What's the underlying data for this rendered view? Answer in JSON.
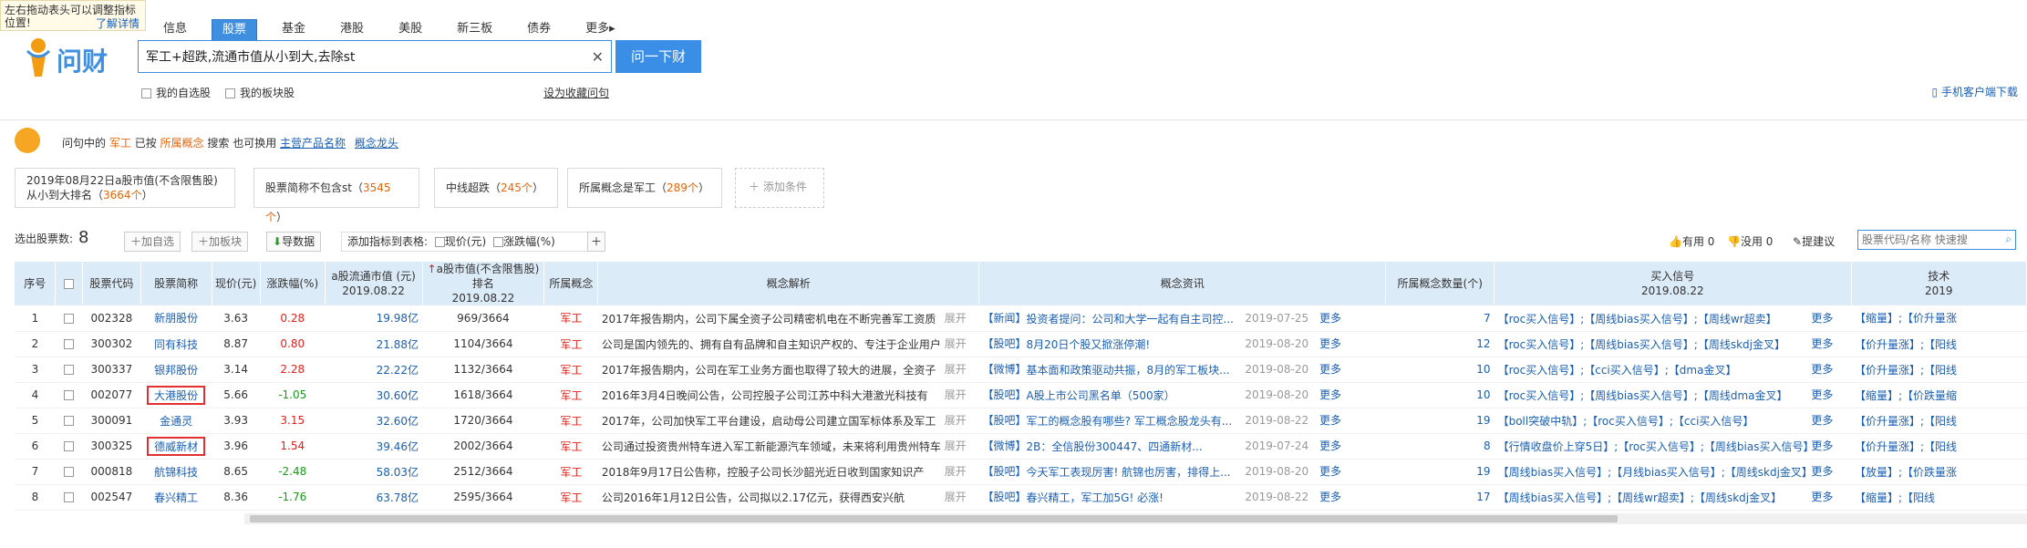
{
  "tooltip": {
    "text": "左右拖动表头可以调整指标位置!",
    "link": "了解详情"
  },
  "logo": {
    "text": "问财"
  },
  "nav": [
    "信息",
    "股票",
    "基金",
    "港股",
    "美股",
    "新三板",
    "债券",
    "更多▸"
  ],
  "search": {
    "value": "军工+超跌,流通市值从小到大,去除st",
    "button": "问一下财"
  },
  "options": {
    "self_select": "我的自选股",
    "my_block": "我的板块股",
    "save_question": "设为收藏问句",
    "phone": "手机客户端下载"
  },
  "info": {
    "prefix": "问句中的",
    "kw": "军工",
    "mid": "已按",
    "concept": "所属概念",
    "mid2": "搜索   也可换用",
    "alt1": "主营产品名称",
    "alt2": "概念龙头"
  },
  "conditions": [
    {
      "label": "2019年08月22日a股市值(不含限售股)从小到大排名",
      "count": "3664个"
    },
    {
      "label": "股票简称不包含st",
      "count": "3545个"
    },
    {
      "label": "中线超跌",
      "count": "245个"
    },
    {
      "label": "所属概念是军工",
      "count": "289个"
    },
    {
      "label": "添加条件",
      "count": ""
    }
  ],
  "toolbar": {
    "count_label": "选出股票数:",
    "count": "8",
    "add_select": "加自选",
    "add_block": "加板块",
    "export": "导数据",
    "add_indicator": "添加指标到表格:",
    "price_chk": "现价(元)",
    "change_chk": "涨跌幅(%)",
    "useful": "有用 0",
    "useless": "没用 0",
    "suggest": "提建议",
    "quick_placeholder": "股票代码/名称 快速搜"
  },
  "table": {
    "headers": [
      {
        "l1": "序号",
        "l2": ""
      },
      {
        "l1": "",
        "l2": ""
      },
      {
        "l1": "股票代码",
        "l2": ""
      },
      {
        "l1": "股票简称",
        "l2": ""
      },
      {
        "l1": "现价(元)",
        "l2": ""
      },
      {
        "l1": "涨跌幅(%)",
        "l2": ""
      },
      {
        "l1": "a股流通市值 (元)",
        "l2": "2019.08.22"
      },
      {
        "l1": "a股市值(不含限售股)排名",
        "l2": "2019.08.22"
      },
      {
        "l1": "所属概念",
        "l2": ""
      },
      {
        "l1": "概念解析",
        "l2": ""
      },
      {
        "l1": "概念资讯",
        "l2": ""
      },
      {
        "l1": "所属概念数量(个)",
        "l2": ""
      },
      {
        "l1": "买入信号",
        "l2": "2019.08.22"
      },
      {
        "l1": "技术",
        "l2": "2019"
      }
    ],
    "sort_arrow": "↑",
    "expand": "展开",
    "more": "更多",
    "rows": [
      {
        "no": "1",
        "code": "002328",
        "name": "新朋股份",
        "price": "3.63",
        "chg": "0.28",
        "cap": "19.98亿",
        "rank": "969/3664",
        "concept": "军工",
        "desc": "2017年报告期内，公司下属全资子公司精密机电在不断完善军工资质",
        "news_tag": "【新闻】",
        "news": "投资者提问：公司和大学一起有自主司控...",
        "news_date": "2019-07-25",
        "num": "7",
        "buy": "【roc买入信号】;【周线bias买入信号】;【周线wr超卖】",
        "tech": "【缩量】;【价升量涨"
      },
      {
        "no": "2",
        "code": "300302",
        "name": "同有科技",
        "price": "8.87",
        "chg": "0.80",
        "cap": "21.88亿",
        "rank": "1104/3664",
        "concept": "军工",
        "desc": "公司是国内领先的、拥有自有品牌和自主知识产权的、专注于企业用户市",
        "news_tag": "【股吧】",
        "news": "8月20日个股又掀涨停潮!",
        "news_date": "2019-08-20",
        "num": "12",
        "buy": "【roc买入信号】;【周线bias买入信号】;【周线skdj金叉】",
        "tech": "【价升量涨】;【阳线"
      },
      {
        "no": "3",
        "code": "300337",
        "name": "银邦股份",
        "price": "3.14",
        "chg": "2.28",
        "cap": "22.22亿",
        "rank": "1132/3664",
        "concept": "军工",
        "desc": "2017年报告期内，公司在军工业务方面也取得了较大的进展，全资子",
        "news_tag": "【微博】",
        "news": "基本面和政策驱动共振，8月的军工板块...",
        "news_date": "2019-08-20",
        "num": "10",
        "buy": "【roc买入信号】;【cci买入信号】;【dma金叉】",
        "tech": "【价升量涨】;【阳线"
      },
      {
        "no": "4",
        "code": "002077",
        "name": "大港股份",
        "price": "5.66",
        "chg": "-1.05",
        "cap": "30.60亿",
        "rank": "1618/3664",
        "concept": "军工",
        "desc": "2016年3月4日晚间公告，公司控股子公司江苏中科大港激光科技有",
        "news_tag": "【股吧】",
        "news": "A股上市公司黑名单（500家）",
        "news_date": "2019-08-20",
        "num": "10",
        "buy": "【roc买入信号】;【周线bias买入信号】;【周线dma金叉】",
        "tech": "【缩量】;【价跌量缩"
      },
      {
        "no": "5",
        "code": "300091",
        "name": "金通灵",
        "price": "3.93",
        "chg": "3.15",
        "cap": "32.60亿",
        "rank": "1720/3664",
        "concept": "军工",
        "desc": "2017年，公司加快军工平台建设，启动母公司建立国军标体系及军工",
        "news_tag": "【股吧】",
        "news": "军工的概念股有哪些? 军工概念股龙头有...",
        "news_date": "2019-08-22",
        "num": "19",
        "buy": "【boll突破中轨】;【roc买入信号】;【cci买入信号】",
        "tech": "【价升量涨】;【阳线"
      },
      {
        "no": "6",
        "code": "300325",
        "name": "德威新材",
        "price": "3.96",
        "chg": "1.54",
        "cap": "39.46亿",
        "rank": "2002/3664",
        "concept": "军工",
        "desc": "公司通过投资贵州特车进入军工新能源汽车领域，未来将利用贵州特车的",
        "news_tag": "【微博】",
        "news": "2B：全信股份300447、四通新材...",
        "news_date": "2019-07-24",
        "num": "8",
        "buy": "【行情收盘价上穿5日】;【roc买入信号】;【周线bias买入信号】",
        "tech": "【价升量涨】;【阳线"
      },
      {
        "no": "7",
        "code": "000818",
        "name": "航锦科技",
        "price": "8.65",
        "chg": "-2.48",
        "cap": "58.03亿",
        "rank": "2512/3664",
        "concept": "军工",
        "desc": "2018年9月17日公告称，控股子公司长沙韶光近日收到国家知识产",
        "news_tag": "【股吧】",
        "news": "今天军工表现厉害! 航锦也厉害，排得上...",
        "news_date": "2019-08-20",
        "num": "19",
        "buy": "【周线bias买入信号】;【月线bias买入信号】;【周线skdj金叉】",
        "tech": "【放量】;【价跌量涨"
      },
      {
        "no": "8",
        "code": "002547",
        "name": "春兴精工",
        "price": "8.36",
        "chg": "-1.76",
        "cap": "63.78亿",
        "rank": "2595/3664",
        "concept": "军工",
        "desc": "公司2016年1月12日公告，公司拟以2.17亿元，获得西安兴航",
        "news_tag": "【股吧】",
        "news": "春兴精工，军工加5G! 必涨!",
        "news_date": "2019-08-22",
        "num": "17",
        "buy": "【周线bias买入信号】;【周线wr超卖】;【周线skdj金叉】",
        "tech": "【缩量】;【阳线"
      }
    ]
  },
  "colors": {
    "accent": "#3f8fe0",
    "header_bg": "#dcebf8",
    "up": "#e0201b",
    "down": "#1a9a1a",
    "orange": "#e8650a"
  }
}
